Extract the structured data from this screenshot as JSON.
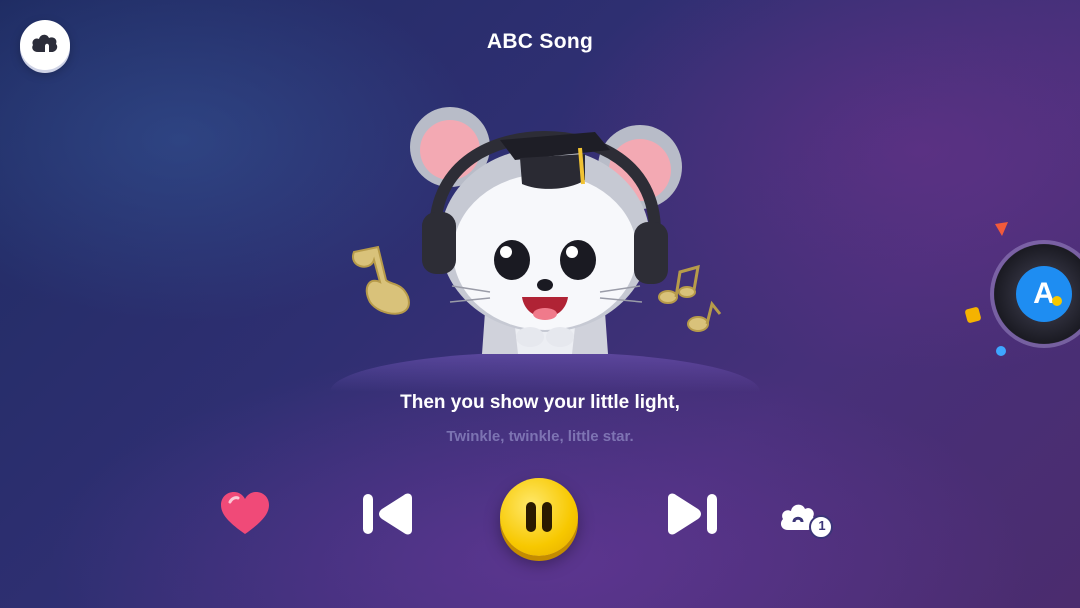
{
  "header": {
    "title": "ABC Song",
    "home_icon": "cloud-home-icon"
  },
  "player": {
    "lyric_current": "Then you show your little light,",
    "lyric_next": "Twinkle, twinkle, little star.",
    "state": "playing"
  },
  "controls": {
    "like_icon": "heart-icon",
    "previous_icon": "previous-track-icon",
    "pause_icon": "pause-icon",
    "next_icon": "next-track-icon",
    "loop_icon": "repeat-one-icon",
    "loop_badge": "1"
  },
  "side_disc": {
    "logo_letter": "A",
    "icon": "record-disc-icon"
  },
  "colors": {
    "accent_yellow": "#f7c800",
    "heart_pink": "#f04a78",
    "text_white": "#ffffff",
    "disc_blue": "#1e8df2"
  }
}
